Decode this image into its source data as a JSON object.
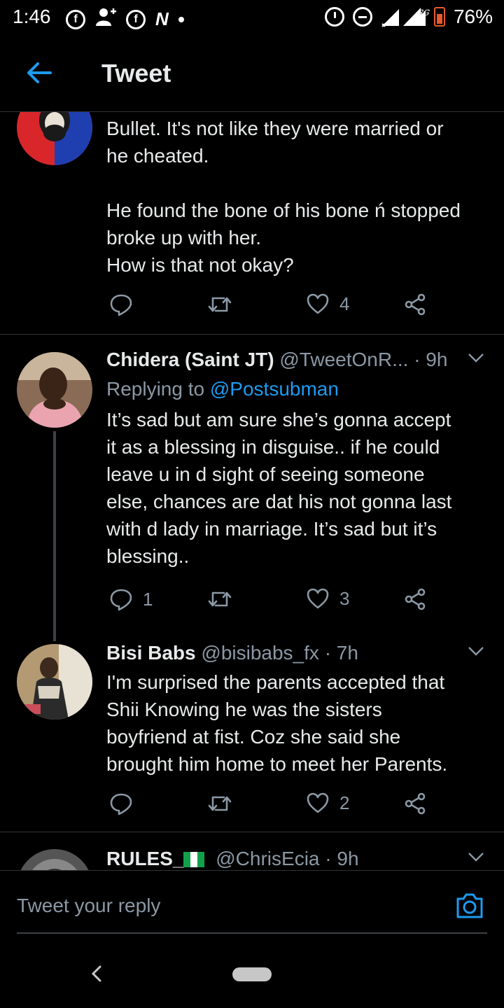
{
  "status_bar": {
    "time": "1:46",
    "battery": "76%",
    "network": "3G",
    "left_icons": [
      "facebook-icon",
      "add-user-icon",
      "facebook-icon",
      "n-app-icon",
      "dot-icon"
    ],
    "right_icons": [
      "alarm-icon",
      "do-not-disturb-icon",
      "signal-icon",
      "battery-icon"
    ]
  },
  "header": {
    "title": "Tweet"
  },
  "tweets": [
    {
      "text": "Bullet. It's not like they were married or\nhe cheated.\n\nHe found the bone of his bone ń stopped\nbroke up with her.\nHow is that not okay?",
      "reply_count": "",
      "retweet_count": "",
      "like_count": "4"
    },
    {
      "name": "Chidera (Saint JT)",
      "handle": "@TweetOnR...",
      "time": "· 9h",
      "replying_prefix": "Replying to",
      "replying_handle": "@Postsubman",
      "text": "It’s sad but am sure she’s gonna accept\nit as a blessing in disguise.. if he could\nleave u in d sight of seeing someone\nelse, chances are dat his not gonna last\nwith d lady in marriage. It’s sad but it’s\nblessing..",
      "reply_count": "1",
      "retweet_count": "",
      "like_count": "3"
    },
    {
      "name": "Bisi Babs",
      "handle": "@bisibabs_fx",
      "time": "· 7h",
      "text": "I'm surprised the parents accepted that\nShii Knowing he was the sisters\nboyfriend at fist. Coz she said she\nbrought him home to meet her Parents.",
      "reply_count": "",
      "retweet_count": "",
      "like_count": "2"
    },
    {
      "name": "RULES_",
      "handle": "@ChrisEcia",
      "time": "· 9h"
    }
  ],
  "reply_bar": {
    "placeholder": "Tweet your reply"
  },
  "colors": {
    "background": "#000000",
    "accent": "#1d9bf0",
    "secondary_text": "#8b98a5",
    "battery_low": "#e65a2c"
  }
}
